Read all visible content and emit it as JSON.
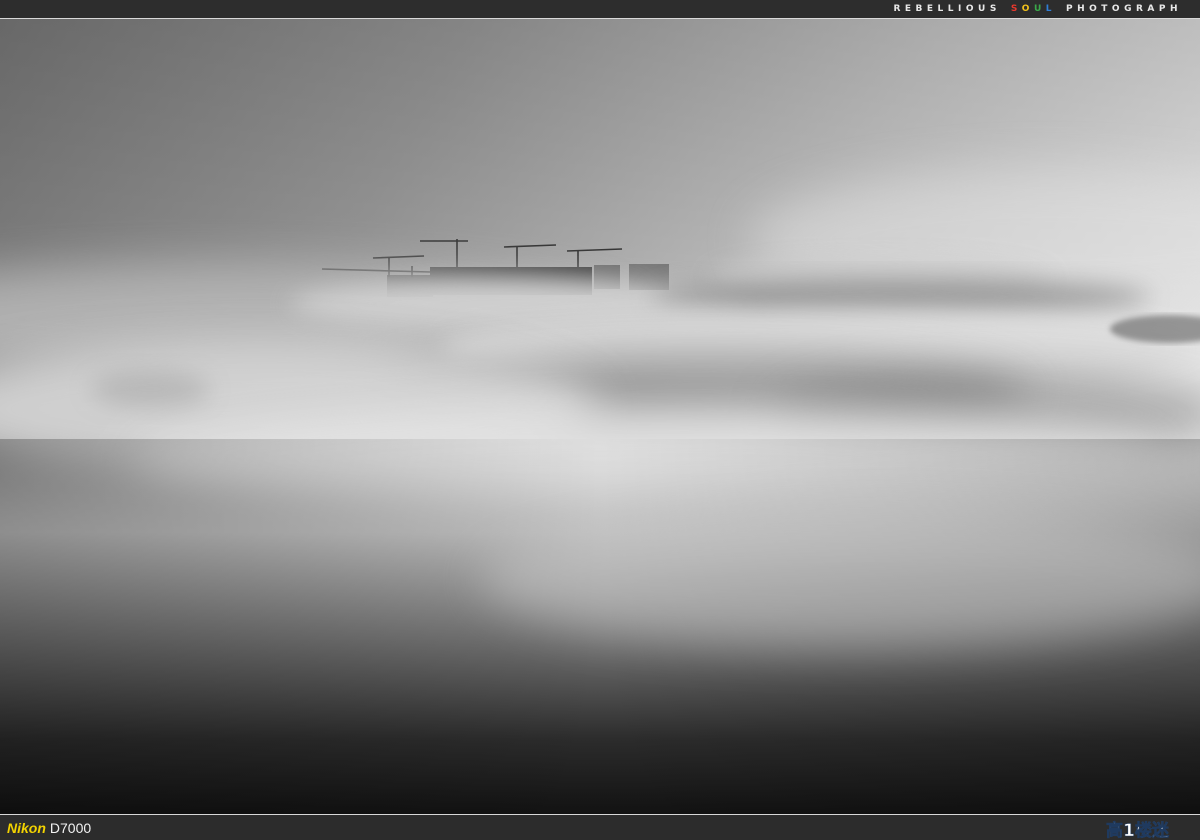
{
  "header": {
    "brand_parts": [
      "REBELLIOUS",
      "SOUL",
      "PHOTOGRAPH"
    ],
    "soul_letters": [
      {
        "char": "S",
        "color": "#e8382d"
      },
      {
        "char": "O",
        "color": "#f2c21b"
      },
      {
        "char": "U",
        "color": "#3aa84a"
      },
      {
        "char": "L",
        "color": "#2f7fd8"
      }
    ]
  },
  "footer": {
    "camera_make": "Nikon",
    "camera_model": "D7000",
    "watermark_text": "高1楼迷",
    "make_color": "#f2d200"
  }
}
